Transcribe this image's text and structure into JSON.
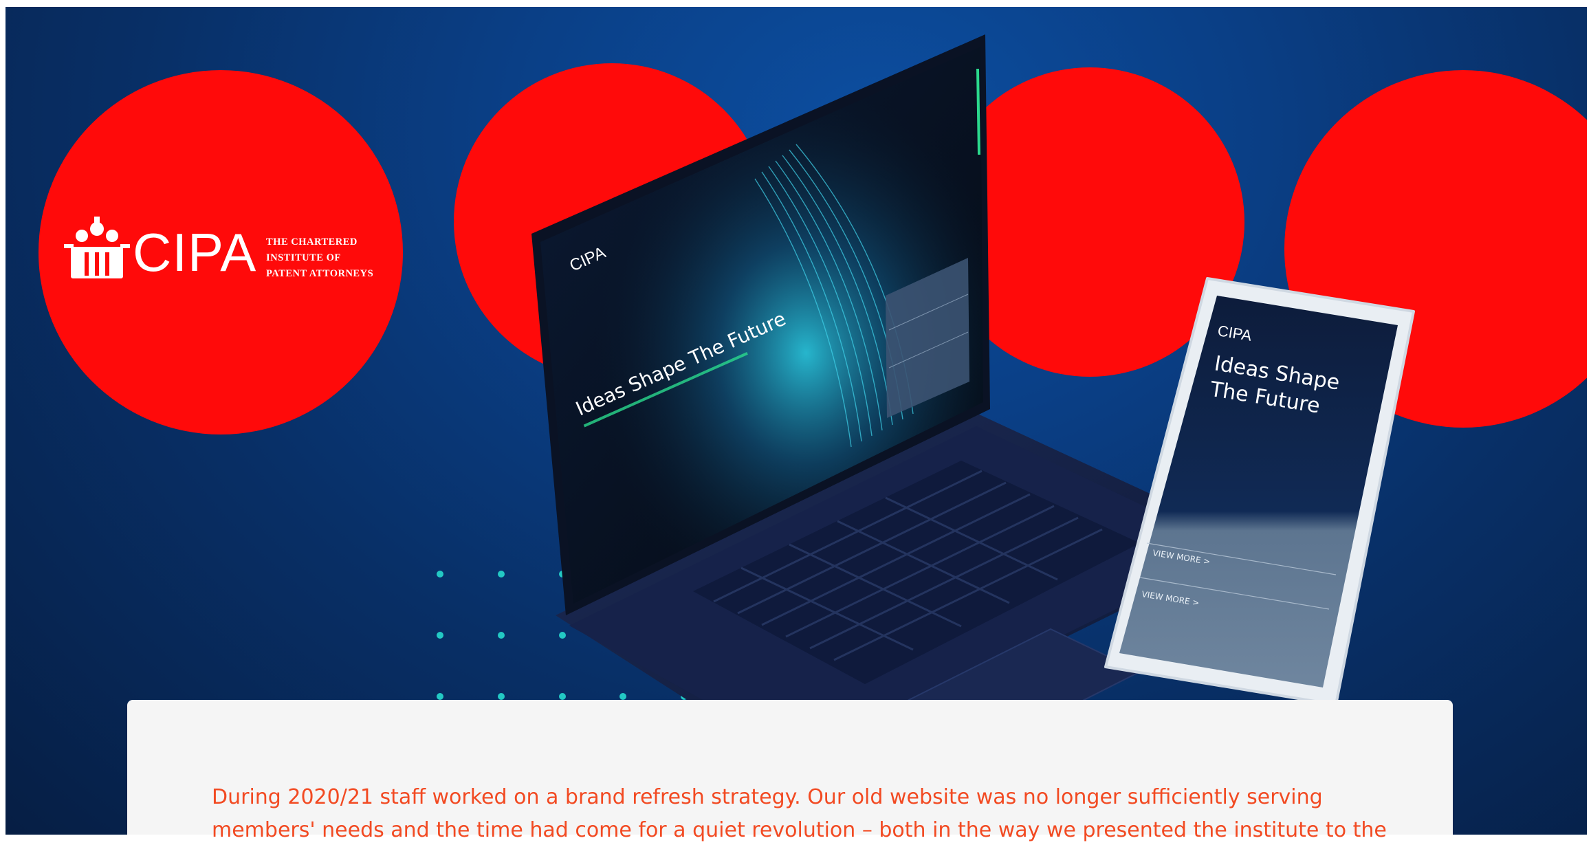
{
  "brand": {
    "name": "CIPA",
    "subtitle_lines": [
      "THE CHARTERED",
      "INSTITUTE OF",
      "PATENT ATTORNEYS"
    ]
  },
  "laptop_screen": {
    "logo": "CIPA",
    "headline": "Ideas Shape The Future"
  },
  "phone_screen": {
    "logo": "CIPA",
    "headline_lines": [
      "Ideas Shape",
      "The Future"
    ],
    "links": [
      "VIEW MORE >",
      "VIEW MORE >"
    ]
  },
  "body_text": "During 2020/21 staff worked on a brand refresh strategy. Our old website was no longer sufficiently serving members' needs and the time had come for a quiet revolution – both in the way we presented the institute to the",
  "colors": {
    "accent_red": "#ff0a0a",
    "hero_blue": "#0a3f86",
    "dot_teal": "#23c9c4",
    "body_text": "#f24a22"
  }
}
